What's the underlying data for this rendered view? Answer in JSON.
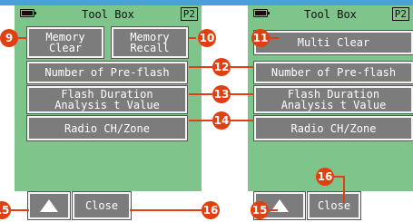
{
  "left": {
    "header": {
      "title": "Tool Box",
      "page": "P2"
    },
    "buttons": {
      "memory_clear": [
        "Memory",
        "Clear"
      ],
      "memory_recall": [
        "Memory",
        "Recall"
      ],
      "pre_flash": "Number of Pre-flash",
      "flash_duration": [
        "Flash Duration",
        "Analysis t Value"
      ],
      "radio": "Radio CH/Zone",
      "close": "Close"
    }
  },
  "right": {
    "header": {
      "title": "Tool Box",
      "page": "P2"
    },
    "buttons": {
      "multi_clear": "Multi Clear",
      "pre_flash": "Number of Pre-flash",
      "flash_duration": [
        "Flash Duration",
        "Analysis t Value"
      ],
      "radio": "Radio CH/Zone",
      "close": "Close"
    }
  },
  "callouts": {
    "c9": "9",
    "c10": "10",
    "c11": "11",
    "c12": "12",
    "c13": "13",
    "c14": "14",
    "c15a": "15",
    "c16a": "16",
    "c15b": "15",
    "c16b": "16",
    "c16c": "16"
  },
  "colors": {
    "accent": "#e0400f",
    "screen": "#7ec48b",
    "button": "#7c7c7c",
    "topbar": "#4aa0d8"
  }
}
